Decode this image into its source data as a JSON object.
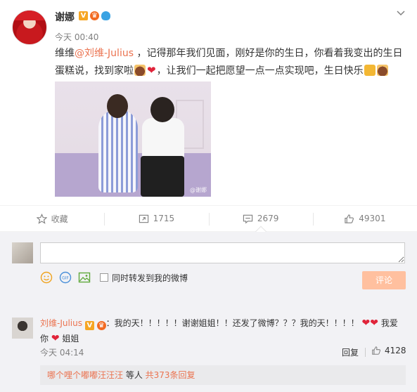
{
  "post": {
    "author": "谢娜",
    "timestamp": "今天 00:40",
    "text_part1": "维维",
    "mention": "@刘维-Julius",
    "text_part2": " ，记得那年我们见面，刚好是你的生日，你看着我变出的生日蛋糕说，找到家啦",
    "text_part3": "，让我们一起把愿望一点一点实现吧，生日快乐",
    "photo_watermark": "@谢娜"
  },
  "actions": {
    "favorite_label": "收藏",
    "repost_count": "1715",
    "comment_count": "2679",
    "like_count": "49301"
  },
  "compose": {
    "sync_label": "同时转发到我的微博",
    "submit_label": "评论"
  },
  "comment": {
    "user": "刘维-Julius",
    "text_part1": "：我的天！！！！！谢谢姐姐！！还发了微博？？？我的天！！！！",
    "text_part2": "我爱",
    "text_part3": "你",
    "text_part4": "姐姐",
    "timestamp": "今天 04:14",
    "reply_label": "回复",
    "like_count": "4128"
  },
  "replies": {
    "names": "哪个哩个嘟嘟汪汪汪",
    "middle": " 等人 ",
    "count_text": "共373条回复"
  },
  "colors": {
    "accent": "#eb7350",
    "submit_bg": "#ffc09f",
    "heart": "#e0243a"
  }
}
